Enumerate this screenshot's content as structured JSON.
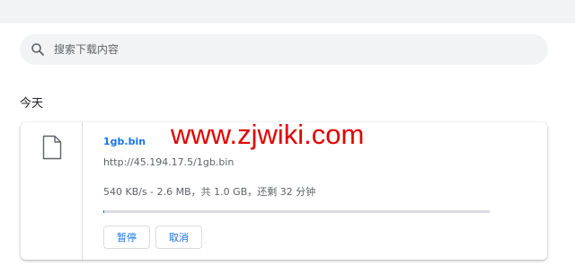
{
  "search": {
    "placeholder": "搜索下载内容",
    "icon": "search-icon"
  },
  "section": {
    "label": "今天"
  },
  "download": {
    "icon": "file-icon",
    "file_name": "1gb.bin",
    "url": "http://45.194.17.5/1gb.bin",
    "status": "540 KB/s - 2.6 MB，共 1.0 GB，还剩 32 分钟",
    "progress": 0.0026,
    "pause_label": "暂停",
    "cancel_label": "取消"
  },
  "watermark": "www.zjwiki.com",
  "colors": {
    "accent": "#1a73e8",
    "watermark": "#e00000",
    "topbar": "#f1f3f4"
  }
}
